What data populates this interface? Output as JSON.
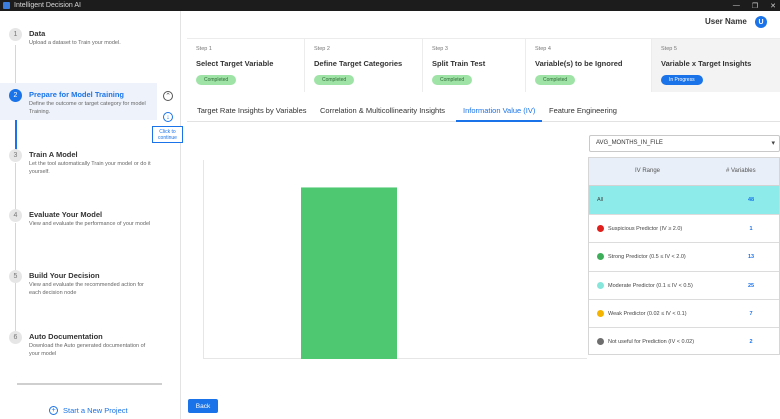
{
  "window": {
    "title": "Intelligent Decision AI",
    "controls": [
      "—",
      "❐",
      "✕"
    ]
  },
  "header": {
    "user_name": "User Name",
    "avatar_initial": "U"
  },
  "sidebar": {
    "steps": [
      {
        "num": "1",
        "title": "Data",
        "desc": "Upload a dataset to Train your model."
      },
      {
        "num": "2",
        "title": "Prepare for Model Training",
        "desc": "Define the outcome or target category for model Training."
      },
      {
        "num": "3",
        "title": "Train A Model",
        "desc": "Let the tool automatically Train your model or do it yourself."
      },
      {
        "num": "4",
        "title": "Evaluate Your Model",
        "desc": "View and evaluate the performance of your model"
      },
      {
        "num": "5",
        "title": "Build Your Decision",
        "desc": "View and evaluate the recommended action for each decision node"
      },
      {
        "num": "6",
        "title": "Auto Documentation",
        "desc": "Download the Auto generated documentation of your model"
      }
    ],
    "tooltip": "Click to continue",
    "new_project": "Start a New Project"
  },
  "progress_steps": [
    {
      "num": "Step 1",
      "name": "Select Target Variable",
      "status": "Completed"
    },
    {
      "num": "Step 2",
      "name": "Define Target Categories",
      "status": "Completed"
    },
    {
      "num": "Step 3",
      "name": "Split Train Test",
      "status": "Completed"
    },
    {
      "num": "Step 4",
      "name": "Variable(s) to be Ignored",
      "status": "Completed"
    },
    {
      "num": "Step 5",
      "name": "Variable x Target Insights",
      "status": "In Progress"
    }
  ],
  "tabs": [
    "Target Rate Insights by Variables",
    "Correlation & Multicollinearity Insights",
    "Information Value (IV)",
    "Feature Engineering"
  ],
  "active_tab": "Information Value (IV)",
  "variable_select": {
    "value": "AVG_MONTHS_IN_FILE"
  },
  "iv_table": {
    "headers": {
      "range": "IV Range",
      "count": "# Variables"
    },
    "rows": [
      {
        "label": "All",
        "count": "48",
        "color": ""
      },
      {
        "label": "Suspicious Predictor (IV ≥ 2.0)",
        "count": "1",
        "color": "#e0201c"
      },
      {
        "label": "Strong Predictor (0.5 ≤ IV < 2.0)",
        "count": "13",
        "color": "#3fae5a"
      },
      {
        "label": "Moderate Predictor (0.1 ≤ IV < 0.5)",
        "count": "25",
        "color": "#86e6dc"
      },
      {
        "label": "Weak Predictor (0.02 ≤ IV < 0.1)",
        "count": "7",
        "color": "#f4b400"
      },
      {
        "label": "Not useful for Prediction (IV < 0.02)",
        "count": "2",
        "color": "#6e6e6e"
      }
    ]
  },
  "chart_data": {
    "type": "bar",
    "categories": [
      ""
    ],
    "values": [
      1
    ],
    "ylim": [
      0,
      1.16
    ],
    "bar_color": "#4fc872",
    "xlabel": "",
    "ylabel": "",
    "title": ""
  },
  "buttons": {
    "back": "Back"
  },
  "colors": {
    "accent": "#1a73e8",
    "completed_badge": "#9fe3a7",
    "all_row_bg": "#8debea"
  }
}
